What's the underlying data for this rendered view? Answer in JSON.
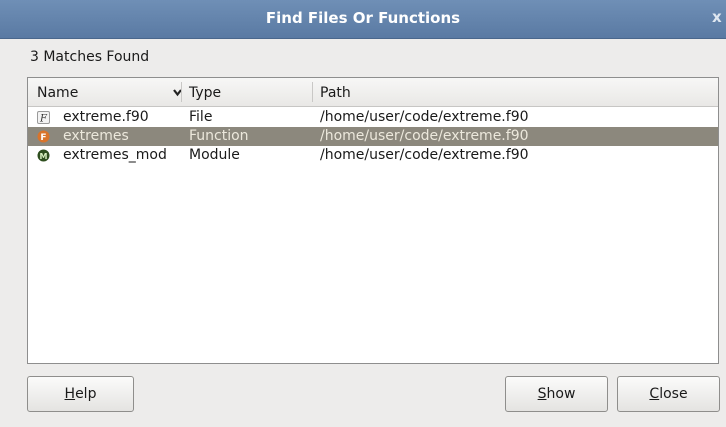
{
  "window": {
    "title": "Find Files Or Functions",
    "close_glyph": "x"
  },
  "status": {
    "matches_text": "3 Matches Found"
  },
  "table": {
    "columns": {
      "name": "Name",
      "type": "Type",
      "path": "Path"
    },
    "sort_indicator_icon": "chevron-down-icon",
    "rows": [
      {
        "icon": "file-icon",
        "icon_glyph": "F",
        "name": "extreme.f90",
        "type": "File",
        "path": "/home/user/code/extreme.f90",
        "selected": false
      },
      {
        "icon": "function-icon",
        "icon_glyph": "F",
        "name": "extremes",
        "type": "Function",
        "path": "/home/user/code/extreme.f90",
        "selected": true
      },
      {
        "icon": "module-icon",
        "icon_glyph": "M",
        "name": "extremes_mod",
        "type": "Module",
        "path": "/home/user/code/extreme.f90",
        "selected": false
      }
    ]
  },
  "buttons": {
    "help": {
      "mnemonic": "H",
      "rest": "elp"
    },
    "show": {
      "mnemonic": "S",
      "rest": "how"
    },
    "close": {
      "mnemonic": "C",
      "rest": "lose"
    }
  },
  "colors": {
    "title_bar": "#6384ad",
    "selection": "#8c887d",
    "function_icon": "#d9742b",
    "module_icon": "#2f4f1f"
  }
}
